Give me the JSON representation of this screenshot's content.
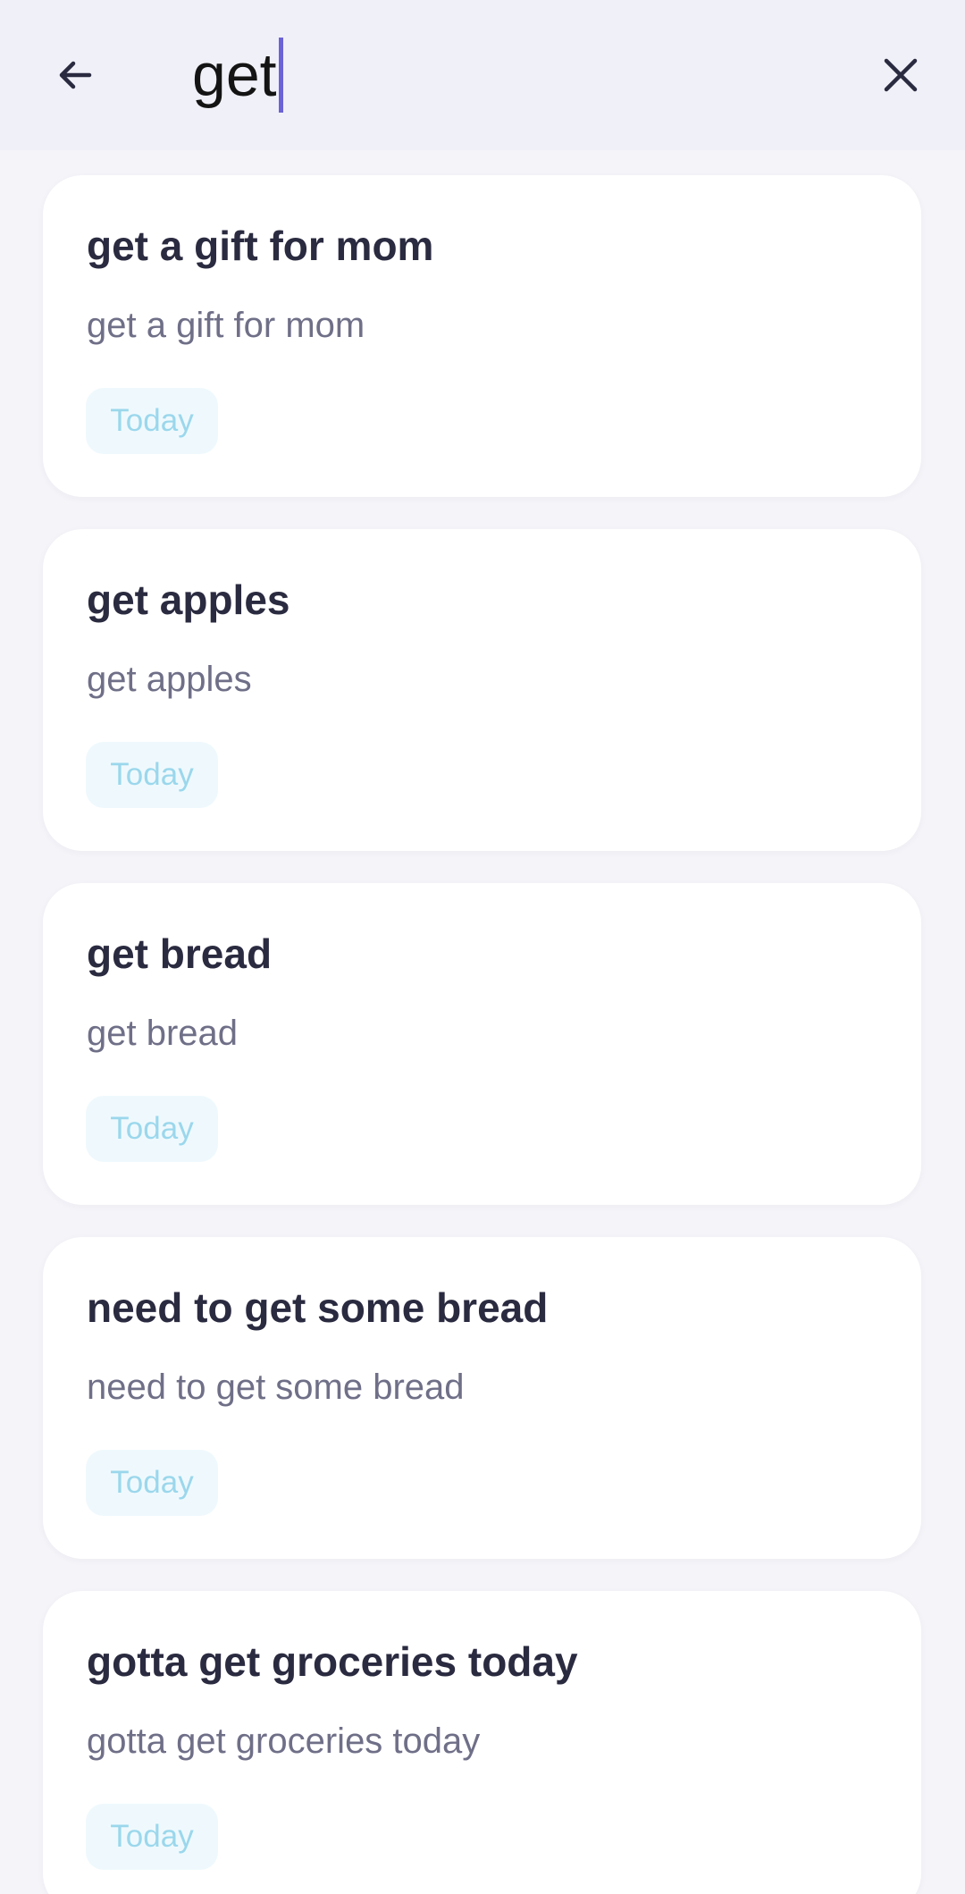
{
  "search": {
    "value": "get"
  },
  "icons": {
    "back": "arrow-left-icon",
    "clear": "close-icon"
  },
  "colors": {
    "caret": "#6b63d6",
    "badge_bg": "#eff9fd",
    "badge_text": "#9bd7ec",
    "title": "#2a2a40",
    "note": "#6f6f88"
  },
  "results": [
    {
      "title": "get a gift for mom",
      "note": "get a gift for mom",
      "due": "Today"
    },
    {
      "title": "get apples",
      "note": "get apples",
      "due": "Today"
    },
    {
      "title": "get bread",
      "note": "get bread",
      "due": "Today"
    },
    {
      "title": "need to get some bread",
      "note": "need to get some bread",
      "due": "Today"
    },
    {
      "title": "gotta get groceries today",
      "note": "gotta get groceries today",
      "due": "Today"
    }
  ]
}
